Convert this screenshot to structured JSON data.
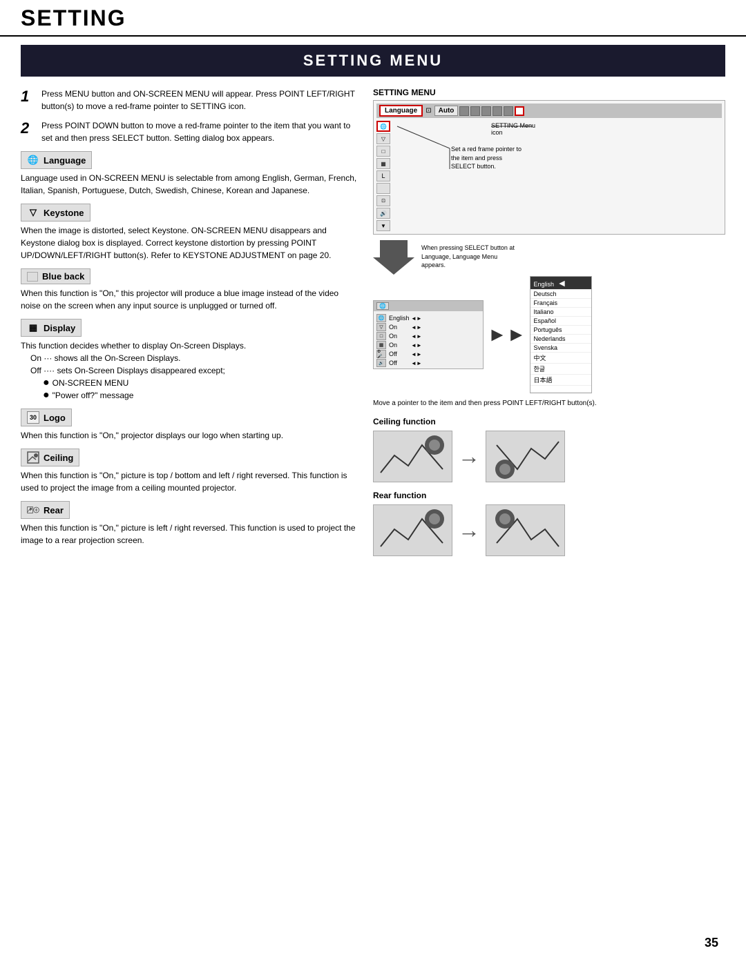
{
  "page": {
    "title": "SETTING",
    "section_title": "SETTING MENU",
    "page_number": "35"
  },
  "steps": [
    {
      "number": "1",
      "text": "Press MENU button and ON-SCREEN MENU will appear.  Press POINT LEFT/RIGHT button(s) to move a red-frame pointer to SETTING icon."
    },
    {
      "number": "2",
      "text": "Press POINT DOWN button to move a red-frame pointer to the item that you want to set and then press SELECT button. Setting dialog box appears."
    }
  ],
  "features": [
    {
      "id": "language",
      "icon": "🌐",
      "label": "Language",
      "text": "Language used in ON-SCREEN MENU is selectable from among English, German, French, Italian, Spanish, Portuguese, Dutch, Swedish, Chinese, Korean and Japanese."
    },
    {
      "id": "keystone",
      "icon": "▽",
      "label": "Keystone",
      "text": "When the image is distorted, select Keystone.  ON-SCREEN MENU disappears and Keystone dialog box is displayed.  Correct keystone distortion by pressing POINT UP/DOWN/LEFT/RIGHT button(s). Refer to KEYSTONE ADJUSTMENT on page 20."
    },
    {
      "id": "blue-back",
      "icon": "□",
      "label": "Blue back",
      "text": "When this function is \"On,\" this projector will produce a blue image instead of the video noise on the screen when any input source is unplugged or turned off."
    },
    {
      "id": "display",
      "icon": "▦",
      "label": "Display",
      "text": "This function decides whether to display On-Screen Displays.",
      "bullets": [
        "On  ···  shows all the On-Screen Displays.",
        "Off ···· sets On-Screen Displays disappeared except;"
      ],
      "sub_bullets": [
        "ON-SCREEN MENU",
        "\"Power off?\" message"
      ]
    },
    {
      "id": "logo",
      "icon": "30",
      "label": "Logo",
      "text": "When this function is \"On,\" projector displays our logo when starting up."
    },
    {
      "id": "ceiling",
      "icon": "⊡",
      "label": "Ceiling",
      "text": "When this function is \"On,\" picture is top / bottom and left / right reversed.  This function is used to project the image from a ceiling mounted projector."
    },
    {
      "id": "rear",
      "icon": "🔊",
      "label": "Rear",
      "text": "When this function is \"On,\" picture is left / right reversed.  This function is used to project the image to a rear projection screen."
    }
  ],
  "right_panel": {
    "setting_menu_label": "SETTING MENU",
    "menu_bar": {
      "language_item": "Language",
      "auto_item": "Auto"
    },
    "annotations": {
      "red_frame": "Set a red frame pointer to the item and press SELECT button.",
      "setting_icon": "SETTING Menu icon"
    },
    "arrow_note": "When pressing SELECT button at Language, Language Menu appears.",
    "language_current": "English",
    "languages": [
      {
        "name": "English",
        "selected": true
      },
      {
        "name": "Deutsch",
        "selected": false
      },
      {
        "name": "Français",
        "selected": false
      },
      {
        "name": "Italiano",
        "selected": false
      },
      {
        "name": "Español",
        "selected": false
      },
      {
        "name": "Português",
        "selected": false
      },
      {
        "name": "Nederlands",
        "selected": false
      },
      {
        "name": "Svenska",
        "selected": false
      },
      {
        "name": "中文",
        "selected": false
      },
      {
        "name": "한글",
        "selected": false
      },
      {
        "name": "日本語",
        "selected": false
      }
    ],
    "lang_note": "Move a pointer to the item and then press POINT LEFT/RIGHT button(s).",
    "ceiling_function_label": "Ceiling function",
    "rear_function_label": "Rear function"
  }
}
